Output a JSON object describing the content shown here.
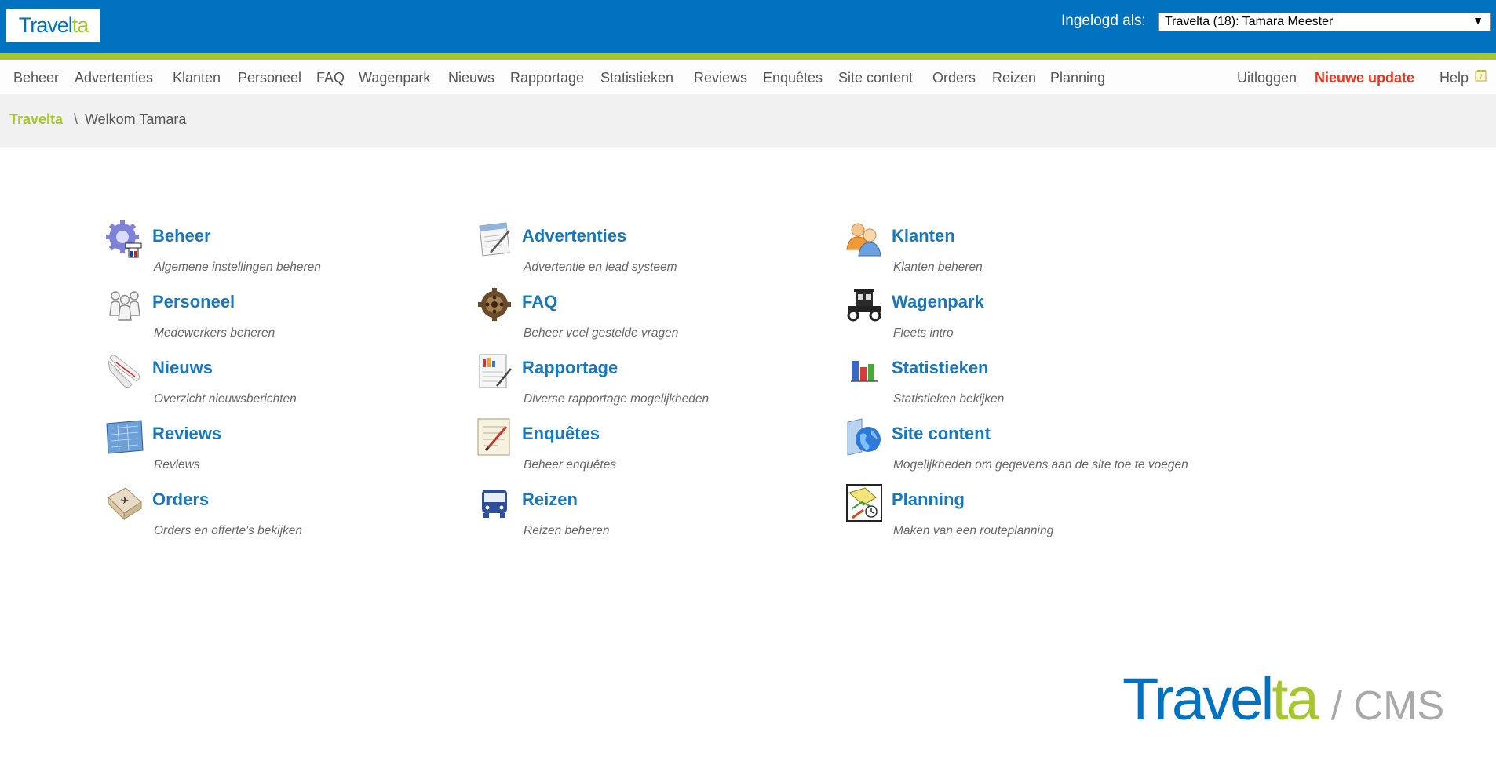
{
  "header": {
    "logo_part1": "Travel",
    "logo_part2": "ta",
    "login_label": "Ingelogd als:",
    "user_selected": "Travelta (18): Tamara Meester"
  },
  "nav": {
    "items": [
      "Beheer",
      "Advertenties",
      "Klanten",
      "Personeel",
      "FAQ",
      "Wagenpark",
      "Nieuws",
      "Rapportage",
      "Statistieken",
      "Reviews",
      "Enquêtes",
      "Site content",
      "Orders",
      "Reizen",
      "Planning"
    ],
    "logout": "Uitloggen",
    "update": "Nieuwe update",
    "help": "Help"
  },
  "breadcrumb": {
    "home": "Travelta",
    "separator": "\\",
    "current": "Welkom Tamara"
  },
  "tiles": [
    {
      "title": "Beheer",
      "desc": "Algemene instellingen beheren",
      "icon": "gear-icon"
    },
    {
      "title": "Advertenties",
      "desc": "Advertentie en lead systeem",
      "icon": "notepad-icon"
    },
    {
      "title": "Klanten",
      "desc": "Klanten beheren",
      "icon": "users-icon"
    },
    {
      "title": "Personeel",
      "desc": "Medewerkers beheren",
      "icon": "people-outline-icon"
    },
    {
      "title": "FAQ",
      "desc": "Beheer veel gestelde vragen",
      "icon": "cog-wheel-icon"
    },
    {
      "title": "Wagenpark",
      "desc": "Fleets intro",
      "icon": "vintage-car-icon"
    },
    {
      "title": "Nieuws",
      "desc": "Overzicht nieuwsberichten",
      "icon": "scroll-icon"
    },
    {
      "title": "Rapportage",
      "desc": "Diverse rapportage mogelijkheden",
      "icon": "report-icon"
    },
    {
      "title": "Statistieken",
      "desc": "Statistieken bekijken",
      "icon": "bar-chart-icon"
    },
    {
      "title": "Reviews",
      "desc": "Reviews",
      "icon": "blueprint-icon"
    },
    {
      "title": "Enquêtes",
      "desc": "Beheer enquêtes",
      "icon": "survey-icon"
    },
    {
      "title": "Site content",
      "desc": "Mogelijkheden om gegevens aan de site toe te voegen",
      "icon": "globe-icon"
    },
    {
      "title": "Orders",
      "desc": "Orders en offerte's bekijken",
      "icon": "airmail-icon"
    },
    {
      "title": "Reizen",
      "desc": "Reizen beheren",
      "icon": "bus-icon"
    },
    {
      "title": "Planning",
      "desc": "Maken van een routeplanning",
      "icon": "planning-map-icon"
    }
  ],
  "footer": {
    "logo_part1": "Travel",
    "logo_part2": "ta",
    "cms": "/ CMS"
  },
  "colors": {
    "header_blue": "#0172bf",
    "accent_green": "#a6c631",
    "link_blue": "#1878bd",
    "update_red": "#e6361d"
  }
}
